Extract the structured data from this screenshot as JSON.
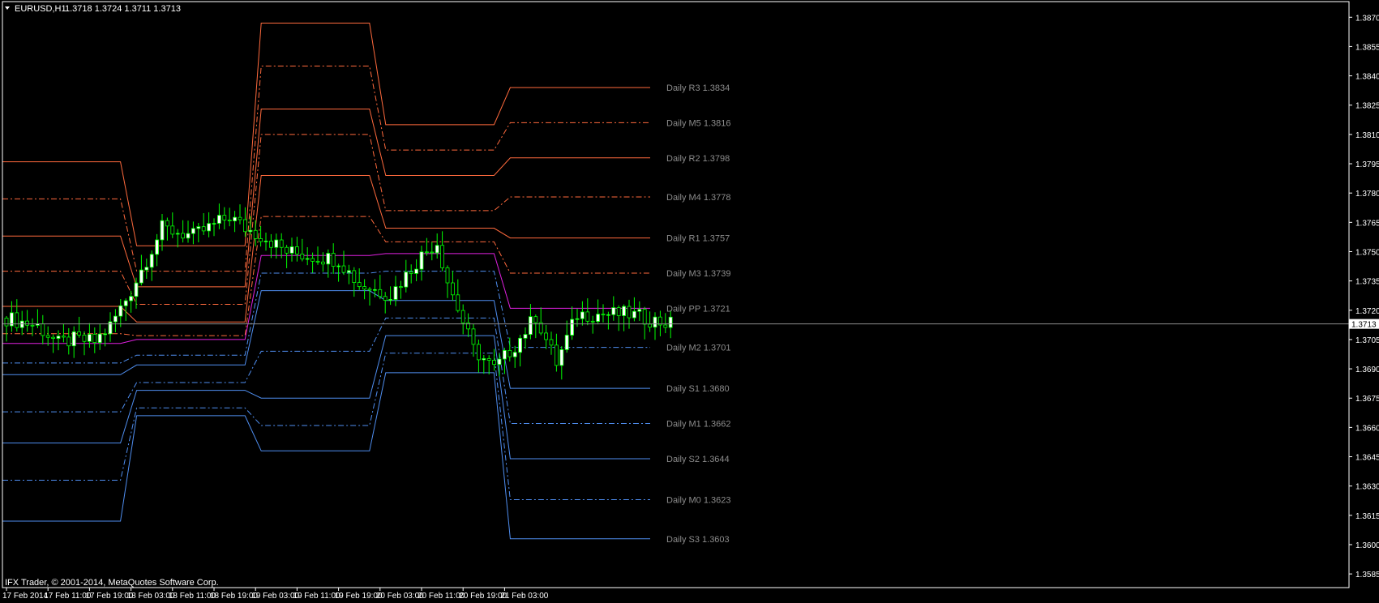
{
  "header": {
    "symbol_label": "EURUSD,H1",
    "ohlc_label": "1.3718 1.3724 1.3711 1.3713"
  },
  "footer": {
    "copyright": "IFX Trader, © 2001-2014, MetaQuotes Software Corp."
  },
  "price_marker": "1.3713",
  "colors": {
    "background": "#000000",
    "frame": "#ffffff",
    "bull_candle": "#ffffff",
    "bear_candle": "#000000",
    "wick": "#00ff00",
    "resistance": "#ff6a3d",
    "pivot": "#e020e0",
    "support": "#4f8ef0",
    "pivot_text": "#8c8c8c",
    "bid_line": "#8c8c8c"
  },
  "chart_data": {
    "type": "candlestick",
    "symbol": "EURUSD",
    "timeframe": "H1",
    "ylim": [
      1.3578,
      1.3878
    ],
    "y_ticks": [
      "1.3870",
      "1.3855",
      "1.3840",
      "1.3825",
      "1.3810",
      "1.3795",
      "1.3780",
      "1.3765",
      "1.3750",
      "1.3735",
      "1.3720",
      "1.3705",
      "1.3690",
      "1.3675",
      "1.3660",
      "1.3645",
      "1.3630",
      "1.3615",
      "1.3600",
      "1.3585"
    ],
    "x_ticks": [
      "17 Feb 2014",
      "17 Feb 11:00",
      "17 Feb 19:00",
      "18 Feb 03:00",
      "18 Feb 11:00",
      "18 Feb 19:00",
      "19 Feb 03:00",
      "19 Feb 11:00",
      "19 Feb 19:00",
      "20 Feb 03:00",
      "20 Feb 11:00",
      "20 Feb 19:00",
      "21 Feb 03:00"
    ],
    "last_price": 1.3713,
    "candle_anchors": [
      [
        0,
        1.3716
      ],
      [
        6,
        1.3712
      ],
      [
        10,
        1.3703
      ],
      [
        13,
        1.3705
      ],
      [
        17,
        1.3704
      ],
      [
        20,
        1.3712
      ],
      [
        24,
        1.373
      ],
      [
        30,
        1.3762
      ],
      [
        36,
        1.3758
      ],
      [
        43,
        1.3768
      ],
      [
        46,
        1.3762
      ],
      [
        50,
        1.3757
      ],
      [
        54,
        1.375
      ],
      [
        58,
        1.3748
      ],
      [
        64,
        1.3746
      ],
      [
        68,
        1.3733
      ],
      [
        74,
        1.3728
      ],
      [
        80,
        1.3748
      ],
      [
        83,
        1.3755
      ],
      [
        85,
        1.3735
      ],
      [
        90,
        1.37
      ],
      [
        94,
        1.369
      ],
      [
        98,
        1.3702
      ],
      [
        102,
        1.3717
      ],
      [
        106,
        1.3693
      ],
      [
        110,
        1.3718
      ],
      [
        120,
        1.3718
      ],
      [
        126,
        1.3714
      ],
      [
        128,
        1.3713
      ]
    ],
    "day_segments": [
      {
        "day": "17 Feb 2014",
        "R3": 1.3796,
        "M5": 1.3777,
        "R2": 1.3758,
        "M4": 1.374,
        "R1": 1.3722,
        "M3": 1.3708,
        "PP": 1.3703,
        "M2": 1.3693,
        "S1": 1.3687,
        "M1": 1.3668,
        "S2": 1.3652,
        "M0": 1.3633,
        "S3": 1.3612
      },
      {
        "day": "18 Feb 2014",
        "R3": 1.3753,
        "M5": 1.374,
        "R2": 1.3732,
        "M4": 1.3723,
        "R1": 1.3714,
        "M3": 1.3707,
        "PP": 1.3705,
        "M2": 1.3697,
        "S1": 1.3692,
        "M1": 1.3683,
        "S2": 1.3679,
        "M0": 1.367,
        "S3": 1.3666
      },
      {
        "day": "19 Feb 2014",
        "R3": 1.3867,
        "M5": 1.3845,
        "R2": 1.3823,
        "M4": 1.381,
        "R1": 1.3789,
        "M3": 1.3768,
        "PP": 1.3748,
        "M2": 1.3739,
        "S1": 1.373,
        "M1": 1.3699,
        "S2": 1.3675,
        "M0": 1.3661,
        "S3": 1.3648
      },
      {
        "day": "20 Feb 2014",
        "R3": 1.3815,
        "M5": 1.3802,
        "R2": 1.3789,
        "M4": 1.3771,
        "R1": 1.3762,
        "M3": 1.3755,
        "PP": 1.3749,
        "M2": 1.374,
        "S1": 1.3725,
        "M1": 1.3716,
        "S2": 1.3707,
        "M0": 1.3698,
        "S3": 1.3688
      },
      {
        "day": "21 Feb 2014",
        "R3": 1.3834,
        "M5": 1.3816,
        "R2": 1.3798,
        "M4": 1.3778,
        "R1": 1.3757,
        "M3": 1.3739,
        "PP": 1.3721,
        "M2": 1.3701,
        "S1": 1.368,
        "M1": 1.3662,
        "S2": 1.3644,
        "M0": 1.3623,
        "S3": 1.3603
      }
    ],
    "pivot_labels": [
      {
        "key": "R3",
        "text": "Daily R3 1.3834",
        "style": "solid",
        "color": "resistance"
      },
      {
        "key": "M5",
        "text": "Daily M5 1.3816",
        "style": "dashdot",
        "color": "resistance"
      },
      {
        "key": "R2",
        "text": "Daily R2 1.3798",
        "style": "solid",
        "color": "resistance"
      },
      {
        "key": "M4",
        "text": "Daily M4 1.3778",
        "style": "dashdot",
        "color": "resistance"
      },
      {
        "key": "R1",
        "text": "Daily R1 1.3757",
        "style": "solid",
        "color": "resistance"
      },
      {
        "key": "M3",
        "text": "Daily M3 1.3739",
        "style": "dashdot",
        "color": "resistance"
      },
      {
        "key": "PP",
        "text": "Daily PP 1.3721",
        "style": "solid",
        "color": "pivot"
      },
      {
        "key": "M2",
        "text": "Daily M2 1.3701",
        "style": "dashdot",
        "color": "support"
      },
      {
        "key": "S1",
        "text": "Daily S1 1.3680",
        "style": "solid",
        "color": "support"
      },
      {
        "key": "M1",
        "text": "Daily M1 1.3662",
        "style": "dashdot",
        "color": "support"
      },
      {
        "key": "S2",
        "text": "Daily S2 1.3644",
        "style": "solid",
        "color": "support"
      },
      {
        "key": "M0",
        "text": "Daily M0 1.3623",
        "style": "dashdot",
        "color": "support"
      },
      {
        "key": "S3",
        "text": "Daily S3 1.3603",
        "style": "solid",
        "color": "support"
      }
    ],
    "grid": false,
    "legend": "none"
  }
}
